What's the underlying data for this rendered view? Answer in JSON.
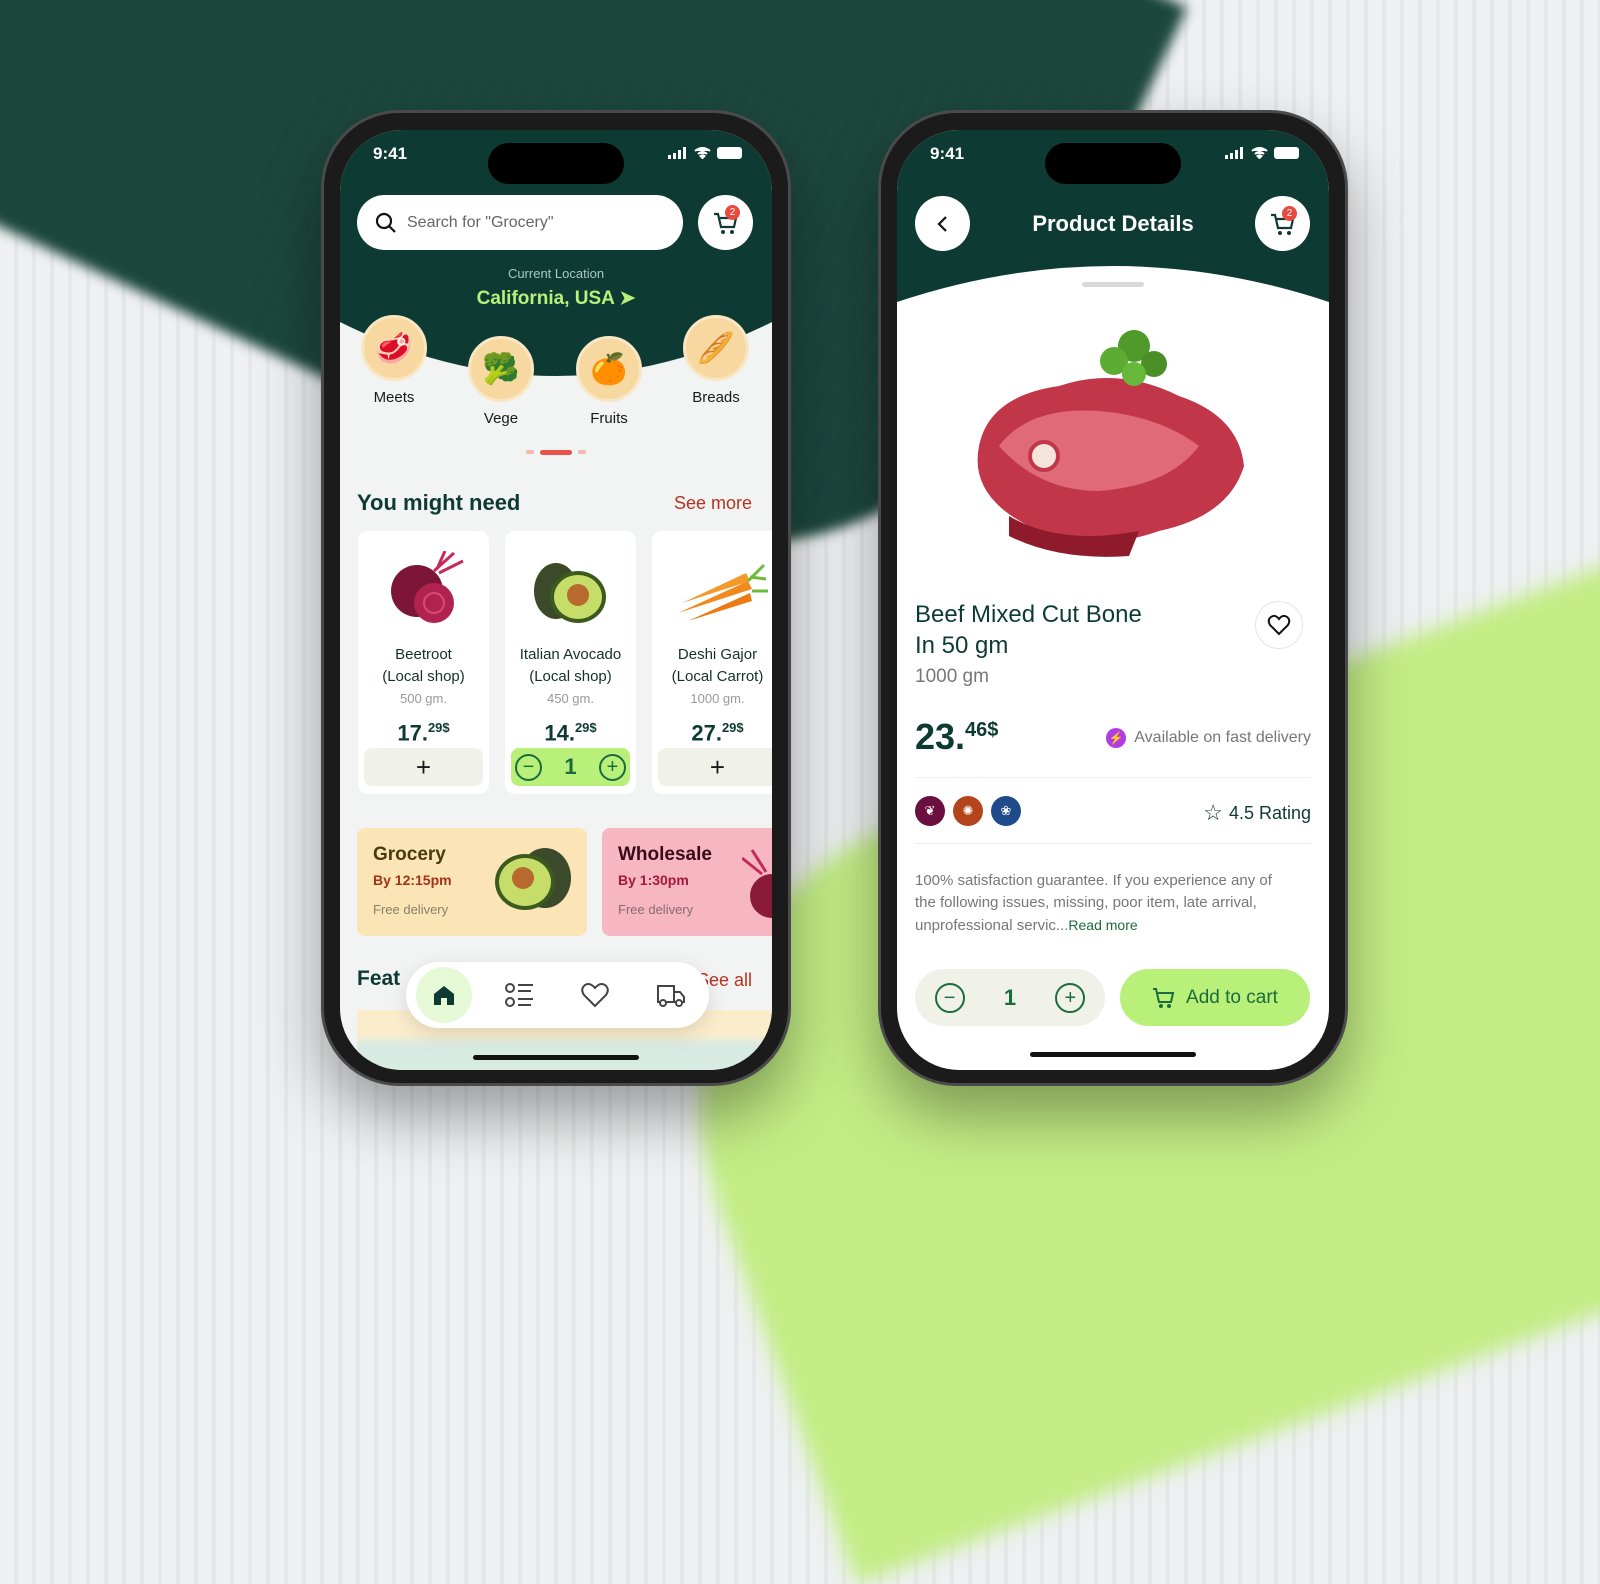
{
  "status": {
    "time": "9:41"
  },
  "colors": {
    "brand_dark": "#0d3b33",
    "accent_lime": "#b8f07a",
    "accent_red": "#b8321f",
    "badge": "#e84a3f"
  },
  "home": {
    "search": {
      "placeholder": "Search for \"Grocery\"",
      "icon": "search-icon"
    },
    "cart": {
      "count": "2",
      "icon": "cart-icon"
    },
    "location": {
      "label": "Current Location",
      "value": "California, USA",
      "icon": "navigation-arrow-icon"
    },
    "categories": [
      {
        "label": "Meets",
        "icon": "meat-icon"
      },
      {
        "label": "Vege",
        "icon": "broccoli-icon"
      },
      {
        "label": "Fruits",
        "icon": "fruit-icon"
      },
      {
        "label": "Breads",
        "icon": "bread-icon"
      }
    ],
    "section": {
      "title": "You might need",
      "link": "See more"
    },
    "products": [
      {
        "name": "Beetroot",
        "shop": "(Local shop)",
        "weight": "500 gm.",
        "price_main": "17.",
        "price_cents": "29$",
        "action": "+"
      },
      {
        "name": "Italian Avocado",
        "shop": "(Local shop)",
        "weight": "450 gm.",
        "price_main": "14.",
        "price_cents": "29$",
        "quantity": "1"
      },
      {
        "name": "Deshi Gajor",
        "shop": "(Local Carrot)",
        "weight": "1000 gm.",
        "price_main": "27.",
        "price_cents": "29$",
        "action": "+"
      }
    ],
    "promos": [
      {
        "title": "Grocery",
        "time": "By 12:15pm",
        "note": "Free delivery"
      },
      {
        "title": "Wholesale",
        "time": "By 1:30pm",
        "note": "Free delivery"
      }
    ],
    "featured": {
      "title": "Feat",
      "link": "See all"
    },
    "nav": [
      "home-icon",
      "list-icon",
      "heart-icon",
      "truck-icon"
    ]
  },
  "detail": {
    "title": "Product Details",
    "cart_count": "2",
    "product": {
      "name_line1": "Beef Mixed Cut Bone",
      "name_line2": "In 50 gm",
      "weight": "1000 gm",
      "price_main": "23.",
      "price_cents": "46$",
      "delivery": "Available on fast delivery",
      "rating": "4.5 Rating",
      "description": "100% satisfaction guarantee. If you experience any of the following issues, missing, poor item, late arrival, unprofessional servic...",
      "read_more": "Read more"
    },
    "badges": [
      {
        "icon": "leaf-icon",
        "color": "#6b0f3f"
      },
      {
        "icon": "seal-icon",
        "color": "#b3441c"
      },
      {
        "icon": "wheat-icon",
        "color": "#1f4b8a"
      }
    ],
    "quantity": "1",
    "add_to_cart": "Add to cart"
  }
}
